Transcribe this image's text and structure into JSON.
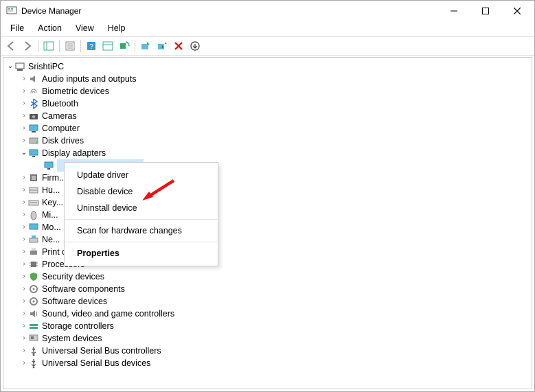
{
  "titlebar": {
    "title": "Device Manager"
  },
  "menubar": {
    "items": [
      "File",
      "Action",
      "View",
      "Help"
    ]
  },
  "toolbar": {
    "buttons": [
      "back-icon",
      "forward-icon",
      "show-hide-icon",
      "properties-icon",
      "help-icon",
      "details-icon",
      "scan-hardware-icon",
      "update-driver-icon",
      "uninstall-icon",
      "disable-icon",
      "add-legacy-icon"
    ]
  },
  "tree": {
    "root": {
      "label": "SrishtiPC"
    },
    "items": [
      {
        "label": "Audio inputs and outputs",
        "icon": "speaker",
        "selected": false
      },
      {
        "label": "Biometric devices",
        "icon": "fingerprint"
      },
      {
        "label": "Bluetooth",
        "icon": "bluetooth"
      },
      {
        "label": "Cameras",
        "icon": "camera"
      },
      {
        "label": "Computer",
        "icon": "computer"
      },
      {
        "label": "Disk drives",
        "icon": "disk"
      },
      {
        "label": "Display adapters",
        "icon": "display",
        "expanded": true
      },
      {
        "label": "Firm...",
        "icon": "chip",
        "truncated_by_menu": true
      },
      {
        "label": "Hu...",
        "icon": "hid",
        "truncated_by_menu": true
      },
      {
        "label": "Key...",
        "icon": "keyboard",
        "truncated_by_menu": true
      },
      {
        "label": "Mi...",
        "icon": "mouse",
        "truncated_by_menu": true
      },
      {
        "label": "Mo...",
        "icon": "monitor",
        "truncated_by_menu": true
      },
      {
        "label": "Ne...",
        "icon": "network",
        "truncated_by_menu": true
      },
      {
        "label": "Print queues",
        "icon": "printer",
        "partially_hidden": true
      },
      {
        "label": "Processors",
        "icon": "cpu"
      },
      {
        "label": "Security devices",
        "icon": "security"
      },
      {
        "label": "Software components",
        "icon": "software"
      },
      {
        "label": "Software devices",
        "icon": "software"
      },
      {
        "label": "Sound, video and game controllers",
        "icon": "sound"
      },
      {
        "label": "Storage controllers",
        "icon": "storage"
      },
      {
        "label": "System devices",
        "icon": "system"
      },
      {
        "label": "Universal Serial Bus controllers",
        "icon": "usb"
      },
      {
        "label": "Universal Serial Bus devices",
        "icon": "usb"
      }
    ],
    "display_child_selected": true
  },
  "context_menu": {
    "items": [
      {
        "label": "Update driver"
      },
      {
        "label": "Disable device"
      },
      {
        "label": "Uninstall device"
      },
      {
        "sep": true
      },
      {
        "label": "Scan for hardware changes"
      },
      {
        "sep": true
      },
      {
        "label": "Properties",
        "bold": true
      }
    ]
  },
  "annotation": {
    "arrow_points_to": "Uninstall device"
  }
}
